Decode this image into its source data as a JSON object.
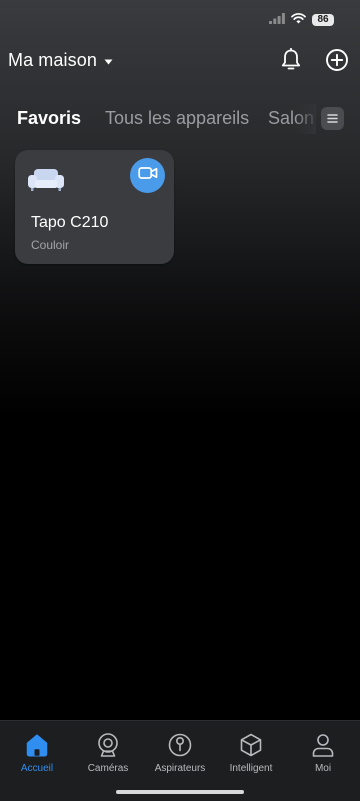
{
  "status_bar": {
    "battery": "86"
  },
  "header": {
    "home_title": "Ma maison"
  },
  "tabs": [
    {
      "label": "Favoris",
      "active": true
    },
    {
      "label": "Tous les appareils",
      "active": false
    },
    {
      "label": "Salon",
      "active": false
    }
  ],
  "devices": [
    {
      "name": "Tapo C210",
      "room": "Couloir",
      "icon": "sofa-icon",
      "action_icon": "video-camera-icon"
    }
  ],
  "bottom_nav": [
    {
      "label": "Accueil",
      "icon": "home-icon",
      "active": true
    },
    {
      "label": "Caméras",
      "icon": "camera-icon",
      "active": false
    },
    {
      "label": "Aspirateurs",
      "icon": "robot-vacuum-icon",
      "active": false
    },
    {
      "label": "Intelligent",
      "icon": "cube-icon",
      "active": false
    },
    {
      "label": "Moi",
      "icon": "person-icon",
      "active": false
    }
  ],
  "colors": {
    "accent": "#2f8ef0",
    "camera_button": "#4a9bea",
    "card_background": "#3a3c3f",
    "nav_background": "#1d1e20"
  }
}
